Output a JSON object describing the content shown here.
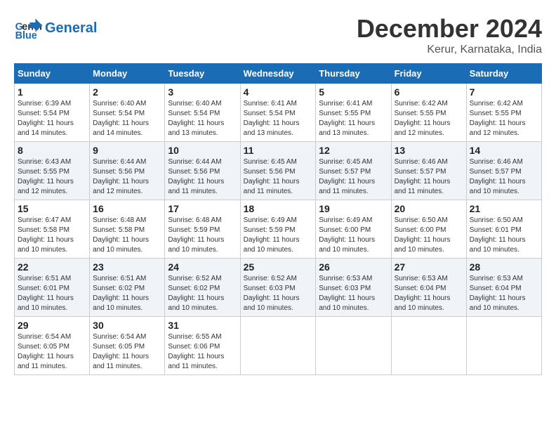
{
  "header": {
    "logo_line1": "General",
    "logo_line2": "Blue",
    "month": "December 2024",
    "location": "Kerur, Karnataka, India"
  },
  "days_of_week": [
    "Sunday",
    "Monday",
    "Tuesday",
    "Wednesday",
    "Thursday",
    "Friday",
    "Saturday"
  ],
  "weeks": [
    [
      {
        "day": "1",
        "sunrise": "6:39 AM",
        "sunset": "5:54 PM",
        "daylight": "11 hours and 14 minutes."
      },
      {
        "day": "2",
        "sunrise": "6:40 AM",
        "sunset": "5:54 PM",
        "daylight": "11 hours and 14 minutes."
      },
      {
        "day": "3",
        "sunrise": "6:40 AM",
        "sunset": "5:54 PM",
        "daylight": "11 hours and 13 minutes."
      },
      {
        "day": "4",
        "sunrise": "6:41 AM",
        "sunset": "5:54 PM",
        "daylight": "11 hours and 13 minutes."
      },
      {
        "day": "5",
        "sunrise": "6:41 AM",
        "sunset": "5:55 PM",
        "daylight": "11 hours and 13 minutes."
      },
      {
        "day": "6",
        "sunrise": "6:42 AM",
        "sunset": "5:55 PM",
        "daylight": "11 hours and 12 minutes."
      },
      {
        "day": "7",
        "sunrise": "6:42 AM",
        "sunset": "5:55 PM",
        "daylight": "11 hours and 12 minutes."
      }
    ],
    [
      {
        "day": "8",
        "sunrise": "6:43 AM",
        "sunset": "5:55 PM",
        "daylight": "11 hours and 12 minutes."
      },
      {
        "day": "9",
        "sunrise": "6:44 AM",
        "sunset": "5:56 PM",
        "daylight": "11 hours and 12 minutes."
      },
      {
        "day": "10",
        "sunrise": "6:44 AM",
        "sunset": "5:56 PM",
        "daylight": "11 hours and 11 minutes."
      },
      {
        "day": "11",
        "sunrise": "6:45 AM",
        "sunset": "5:56 PM",
        "daylight": "11 hours and 11 minutes."
      },
      {
        "day": "12",
        "sunrise": "6:45 AM",
        "sunset": "5:57 PM",
        "daylight": "11 hours and 11 minutes."
      },
      {
        "day": "13",
        "sunrise": "6:46 AM",
        "sunset": "5:57 PM",
        "daylight": "11 hours and 11 minutes."
      },
      {
        "day": "14",
        "sunrise": "6:46 AM",
        "sunset": "5:57 PM",
        "daylight": "11 hours and 10 minutes."
      }
    ],
    [
      {
        "day": "15",
        "sunrise": "6:47 AM",
        "sunset": "5:58 PM",
        "daylight": "11 hours and 10 minutes."
      },
      {
        "day": "16",
        "sunrise": "6:48 AM",
        "sunset": "5:58 PM",
        "daylight": "11 hours and 10 minutes."
      },
      {
        "day": "17",
        "sunrise": "6:48 AM",
        "sunset": "5:59 PM",
        "daylight": "11 hours and 10 minutes."
      },
      {
        "day": "18",
        "sunrise": "6:49 AM",
        "sunset": "5:59 PM",
        "daylight": "11 hours and 10 minutes."
      },
      {
        "day": "19",
        "sunrise": "6:49 AM",
        "sunset": "6:00 PM",
        "daylight": "11 hours and 10 minutes."
      },
      {
        "day": "20",
        "sunrise": "6:50 AM",
        "sunset": "6:00 PM",
        "daylight": "11 hours and 10 minutes."
      },
      {
        "day": "21",
        "sunrise": "6:50 AM",
        "sunset": "6:01 PM",
        "daylight": "11 hours and 10 minutes."
      }
    ],
    [
      {
        "day": "22",
        "sunrise": "6:51 AM",
        "sunset": "6:01 PM",
        "daylight": "11 hours and 10 minutes."
      },
      {
        "day": "23",
        "sunrise": "6:51 AM",
        "sunset": "6:02 PM",
        "daylight": "11 hours and 10 minutes."
      },
      {
        "day": "24",
        "sunrise": "6:52 AM",
        "sunset": "6:02 PM",
        "daylight": "11 hours and 10 minutes."
      },
      {
        "day": "25",
        "sunrise": "6:52 AM",
        "sunset": "6:03 PM",
        "daylight": "11 hours and 10 minutes."
      },
      {
        "day": "26",
        "sunrise": "6:53 AM",
        "sunset": "6:03 PM",
        "daylight": "11 hours and 10 minutes."
      },
      {
        "day": "27",
        "sunrise": "6:53 AM",
        "sunset": "6:04 PM",
        "daylight": "11 hours and 10 minutes."
      },
      {
        "day": "28",
        "sunrise": "6:53 AM",
        "sunset": "6:04 PM",
        "daylight": "11 hours and 10 minutes."
      }
    ],
    [
      {
        "day": "29",
        "sunrise": "6:54 AM",
        "sunset": "6:05 PM",
        "daylight": "11 hours and 11 minutes."
      },
      {
        "day": "30",
        "sunrise": "6:54 AM",
        "sunset": "6:05 PM",
        "daylight": "11 hours and 11 minutes."
      },
      {
        "day": "31",
        "sunrise": "6:55 AM",
        "sunset": "6:06 PM",
        "daylight": "11 hours and 11 minutes."
      },
      null,
      null,
      null,
      null
    ]
  ],
  "labels": {
    "sunrise": "Sunrise:",
    "sunset": "Sunset:",
    "daylight": "Daylight:"
  }
}
